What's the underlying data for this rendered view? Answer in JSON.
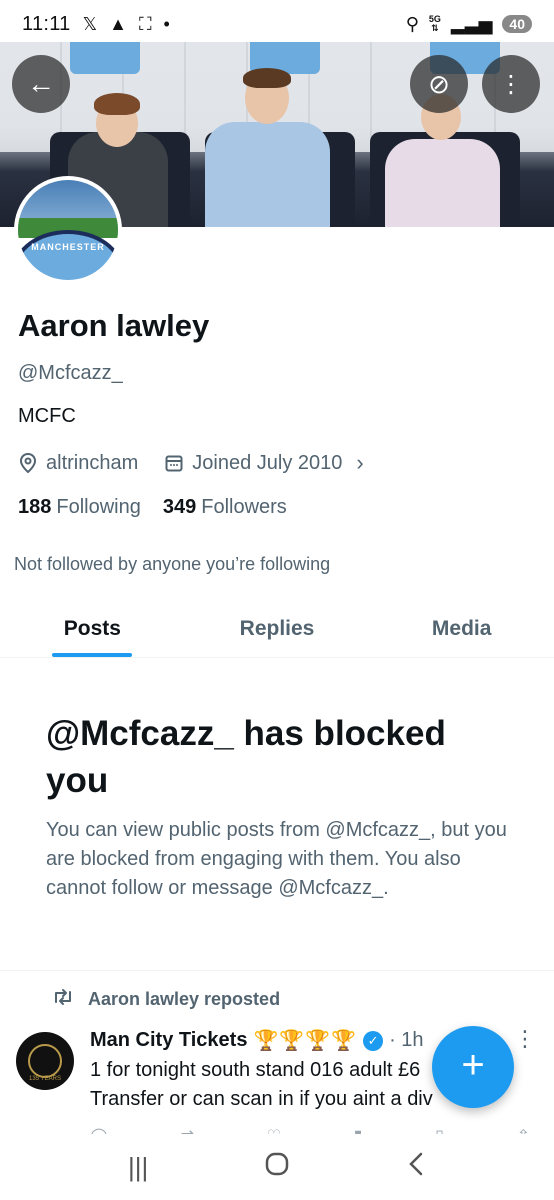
{
  "status_bar": {
    "time": "11:11",
    "left_icons": [
      "x-icon",
      "navigation-icon",
      "screenshot-icon",
      "dot-icon"
    ],
    "network": "5G",
    "battery": "40"
  },
  "header": {
    "back_icon": "arrow-left-icon",
    "grok_icon": "grok-icon",
    "more_icon": "more-vertical-icon"
  },
  "avatar": {
    "text": "MANCHESTER"
  },
  "profile": {
    "name": "Aaron lawley",
    "handle": "@Mcfcazz_",
    "bio": "MCFC",
    "location": "altrincham",
    "joined": "Joined July 2010",
    "following_count": "188",
    "following_label": "Following",
    "followers_count": "349",
    "followers_label": "Followers",
    "not_followed": "Not followed by anyone you’re following"
  },
  "tabs": [
    {
      "label": "Posts",
      "active": true
    },
    {
      "label": "Replies",
      "active": false
    },
    {
      "label": "Media",
      "active": false
    }
  ],
  "blocked": {
    "title": "@Mcfcazz_ has blocked you",
    "text": "You can view public posts from @Mcfcazz_, but you are blocked from engaging with them. You also cannot follow or message @Mcfcazz_."
  },
  "tweet": {
    "repost_label": "Aaron lawley reposted",
    "author": "Man City Tickets",
    "emojis": "🏆🏆🏆🏆",
    "time": "· 1h",
    "avatar_text": "135 YEARS",
    "line1": "1 for tonight south stand 016 adult £6",
    "line2": "Transfer or can scan in if you aint a div"
  },
  "fab": {
    "icon": "plus-icon",
    "label": "+"
  },
  "nav": {
    "recents_icon": "recents-icon",
    "home_icon": "home-icon",
    "back_icon": "back-icon"
  },
  "colors": {
    "accent": "#1d9bf0",
    "text": "#0f1419",
    "muted": "#536471"
  }
}
